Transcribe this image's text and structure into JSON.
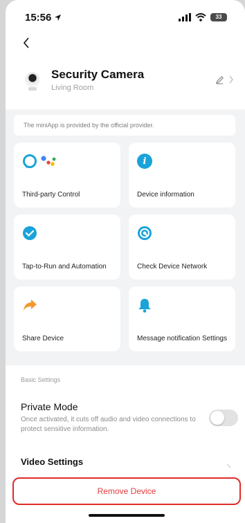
{
  "status_bar": {
    "time": "15:56",
    "battery": "33"
  },
  "device": {
    "name": "Security Camera",
    "room": "Living Room"
  },
  "provider_note": "The miniApp is provided by the official provider.",
  "features": [
    {
      "label": "Third-party Control",
      "icon": "alexa-google-assistant-icon"
    },
    {
      "label": "Device information",
      "icon": "info-icon"
    },
    {
      "label": "Tap-to-Run and Automation",
      "icon": "check-shield-icon"
    },
    {
      "label": "Check Device Network",
      "icon": "network-icon"
    },
    {
      "label": "Share Device",
      "icon": "share-arrow-icon"
    },
    {
      "label": "Message notification Settings",
      "icon": "bell-icon"
    }
  ],
  "basic_settings": {
    "section_label": "Basic Settings",
    "private_mode": {
      "title": "Private Mode",
      "description": "Once activated, it cuts off audio and video connections to protect sensitive information.",
      "enabled": false
    },
    "video_settings": "Video Settings"
  },
  "remove_button": "Remove Device",
  "colors": {
    "remove_accent": "#e23b3b",
    "icon_teal": "#1aa3d9",
    "icon_orange": "#f29a2e"
  }
}
